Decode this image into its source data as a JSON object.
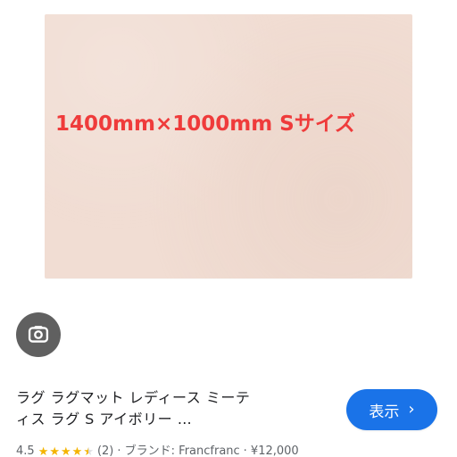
{
  "product_image": {
    "size_text": "1400mm×1000mm Sサイズ",
    "rug_color": "#f1ddd3",
    "overlay_color": "#ef3b3b"
  },
  "lens": {
    "icon": "google-lens-icon",
    "bg_color": "#606060"
  },
  "result": {
    "title_line1": "ラグ ラグマット レディース ミーテ",
    "title_line2": "ィス ラグ S アイボリー …",
    "show_button": {
      "label": "表示",
      "icon": "chevron-right-icon",
      "color": "#1a73e8"
    },
    "meta": {
      "rating": "4.5",
      "stars_value": 4.5,
      "stars_max": 5,
      "review_count": "(2)",
      "brand": "· ブランド: Francfranc",
      "price": "· ¥12,000"
    }
  }
}
